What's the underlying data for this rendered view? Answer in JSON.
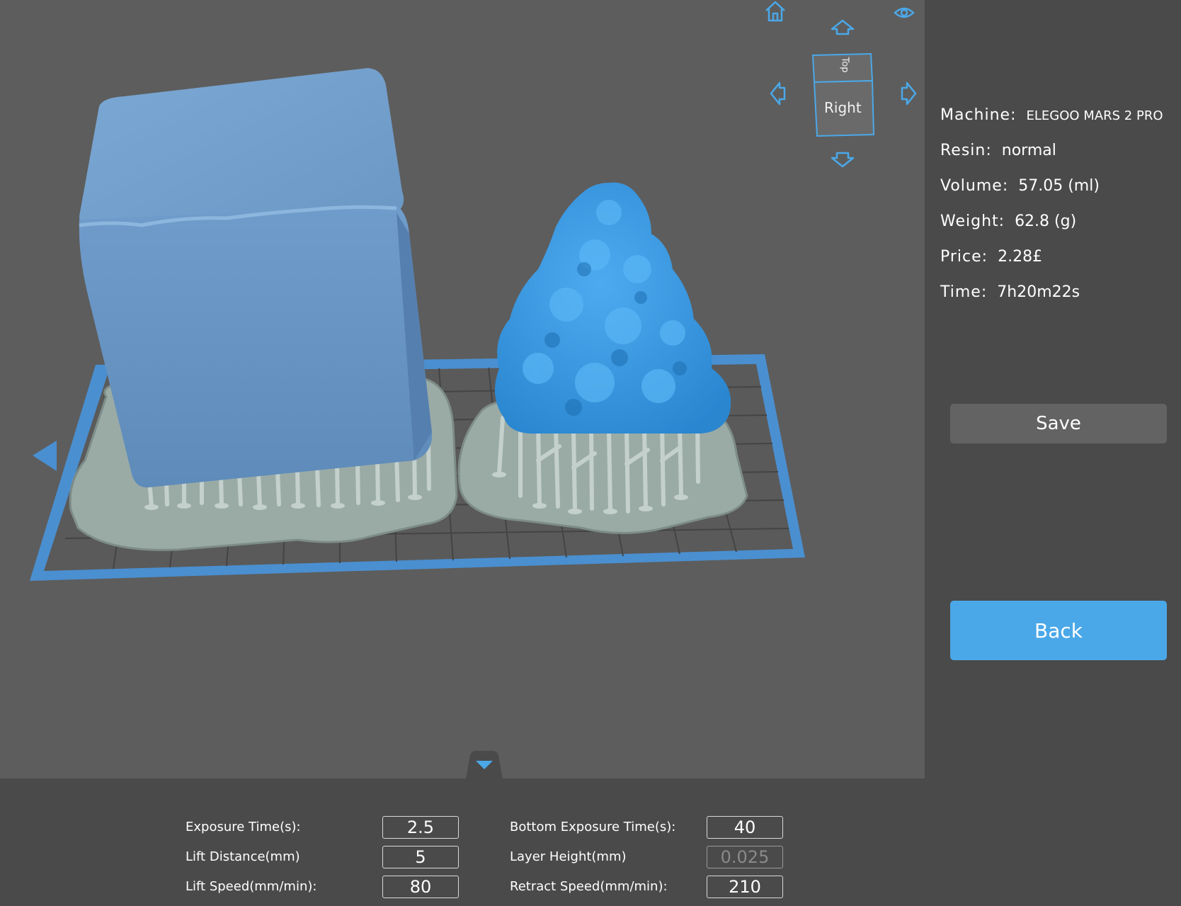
{
  "viewport": {
    "cube": {
      "top_face": "Top",
      "front_face": "Right"
    },
    "icons": {
      "home": "home-icon",
      "visibility": "eye-icon",
      "rotate_up": "arrow-up-icon",
      "rotate_down": "arrow-down-icon",
      "rotate_left": "arrow-left-icon",
      "rotate_right": "arrow-right-icon",
      "collapse": "chevron-down-icon"
    },
    "colors": {
      "accent": "#4ba8e8",
      "build_plate": "#4a8fd0",
      "model_cube": "#6f9cc8",
      "model_pyramid": "#3a97dd",
      "supports": "#aab8b4"
    }
  },
  "info": {
    "machine_label": "Machine:",
    "machine_value": "ELEGOO MARS 2 PRO",
    "resin_label": "Resin:",
    "resin_value": "normal",
    "volume_label": "Volume:",
    "volume_value": "57.05  (ml)",
    "weight_label": "Weight:",
    "weight_value": "62.8  (g)",
    "price_label": "Price:",
    "price_value": "2.28£",
    "time_label": "Time:",
    "time_value": "7h20m22s",
    "save_label": "Save",
    "back_label": "Back"
  },
  "settings": {
    "exposure_time_label": "Exposure Time(s):",
    "exposure_time_value": "2.5",
    "lift_distance_label": "Lift Distance(mm)",
    "lift_distance_value": "5",
    "lift_speed_label": "Lift Speed(mm/min):",
    "lift_speed_value": "80",
    "bottom_exposure_label": "Bottom Exposure Time(s):",
    "bottom_exposure_value": "40",
    "layer_height_label": "Layer Height(mm)",
    "layer_height_value": "0.025",
    "retract_speed_label": "Retract Speed(mm/min):",
    "retract_speed_value": "210"
  }
}
